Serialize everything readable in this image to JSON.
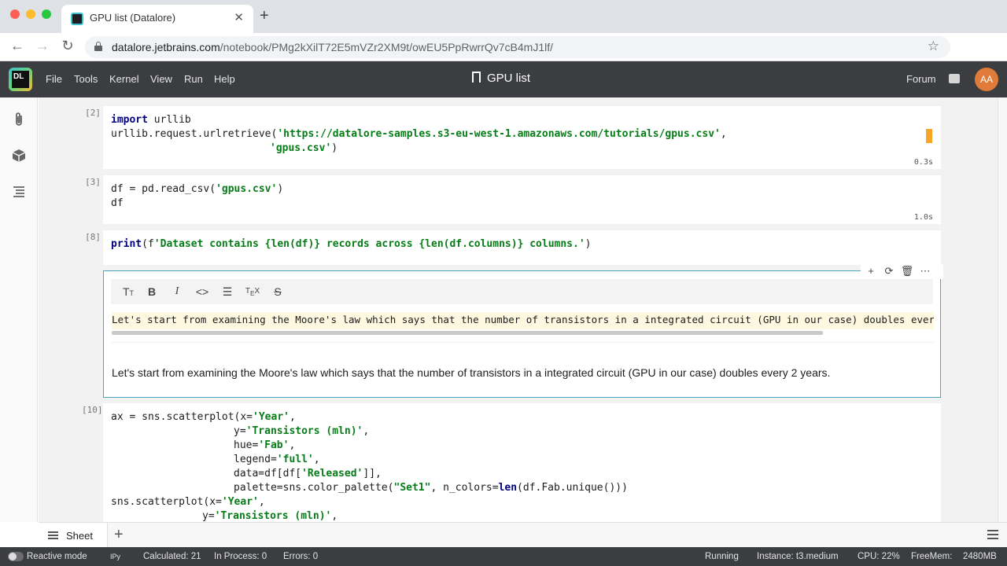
{
  "browser": {
    "tab_title": "GPU list (Datalore)",
    "url_domain": "datalore.jetbrains.com",
    "url_path": "/notebook/PMg2kXilT72E5mVZr2XM9t/owEU5PpRwrrQv7cB4mJ1lf/"
  },
  "app": {
    "logo_text": "DL",
    "menu": [
      "File",
      "Tools",
      "Kernel",
      "View",
      "Run",
      "Help"
    ],
    "notebook_title": "GPU list",
    "forum_label": "Forum",
    "user_initials": "AA"
  },
  "cells": {
    "c2": {
      "number": "[2]",
      "line1_kw": "import",
      "line1_rest": " urllib",
      "line2_pre": "urllib.request.urlretrieve(",
      "line2_str": "'https://datalore-samples.s3-eu-west-1.amazonaws.com/tutorials/gpus.csv'",
      "line2_post": ",",
      "line3_str": "'gpus.csv'",
      "line3_post": ")",
      "exec_time": "0.3s"
    },
    "c3": {
      "number": "[3]",
      "line1_pre": "df = pd.read_csv(",
      "line1_str": "'gpus.csv'",
      "line1_post": ")",
      "line2": "df",
      "exec_time": "1.0s"
    },
    "c8": {
      "number": "[8]",
      "kw": "print",
      "pre": "(f",
      "str": "'Dataset contains {len(df)} records across {len(df.columns)} columns.'",
      "post": ")"
    },
    "markdown": {
      "source": "Let's start from examining the Moore's law which says that the number of transistors in a integrated circuit (GPU in our case) doubles every 2 years.",
      "rendered": "Let's start from examining the Moore's law which says that the number of transistors in a integrated circuit (GPU in our case) doubles every 2 years."
    },
    "c10": {
      "number": "[10]",
      "l1_pre": "ax = sns.scatterplot(x=",
      "l1_str": "'Year'",
      "l1_post": ",",
      "l2_pre": "y=",
      "l2_str": "'Transistors (mln)'",
      "l2_post": ",",
      "l3_pre": "hue=",
      "l3_str": "'Fab'",
      "l3_post": ",",
      "l4_pre": "legend=",
      "l4_str": "'full'",
      "l4_post": ",",
      "l5_pre": "data=df[df[",
      "l5_str": "'Released'",
      "l5_post": "]],",
      "l6_pre": "palette=sns.color_palette(",
      "l6_str": "\"Set1\"",
      "l6_mid": ", n_colors=",
      "l6_kw": "len",
      "l6_post": "(df.Fab.unique()))",
      "l7_pre": "sns.scatterplot(x=",
      "l7_str": "'Year'",
      "l7_post": ",",
      "l8_pre": "y=",
      "l8_str": "'Transistors (mln)'",
      "l8_post": ","
    }
  },
  "sheetbar": {
    "tab_label": "Sheet"
  },
  "status": {
    "reactive_mode": "Reactive mode",
    "ipy": "IPy",
    "calculated": "Calculated: 21",
    "in_process": "In Process: 0",
    "errors": "Errors: 0",
    "running": "Running",
    "instance": "Instance: t3.medium",
    "cpu": "CPU:  22%",
    "freemem_label": "FreeMem:",
    "freemem_value": "2480MB"
  },
  "colors": {
    "accent": "#4aa3c1",
    "app_header": "#3b3d40",
    "string": "#067d17",
    "keyword": "#000080",
    "marker": "#f5a623"
  }
}
